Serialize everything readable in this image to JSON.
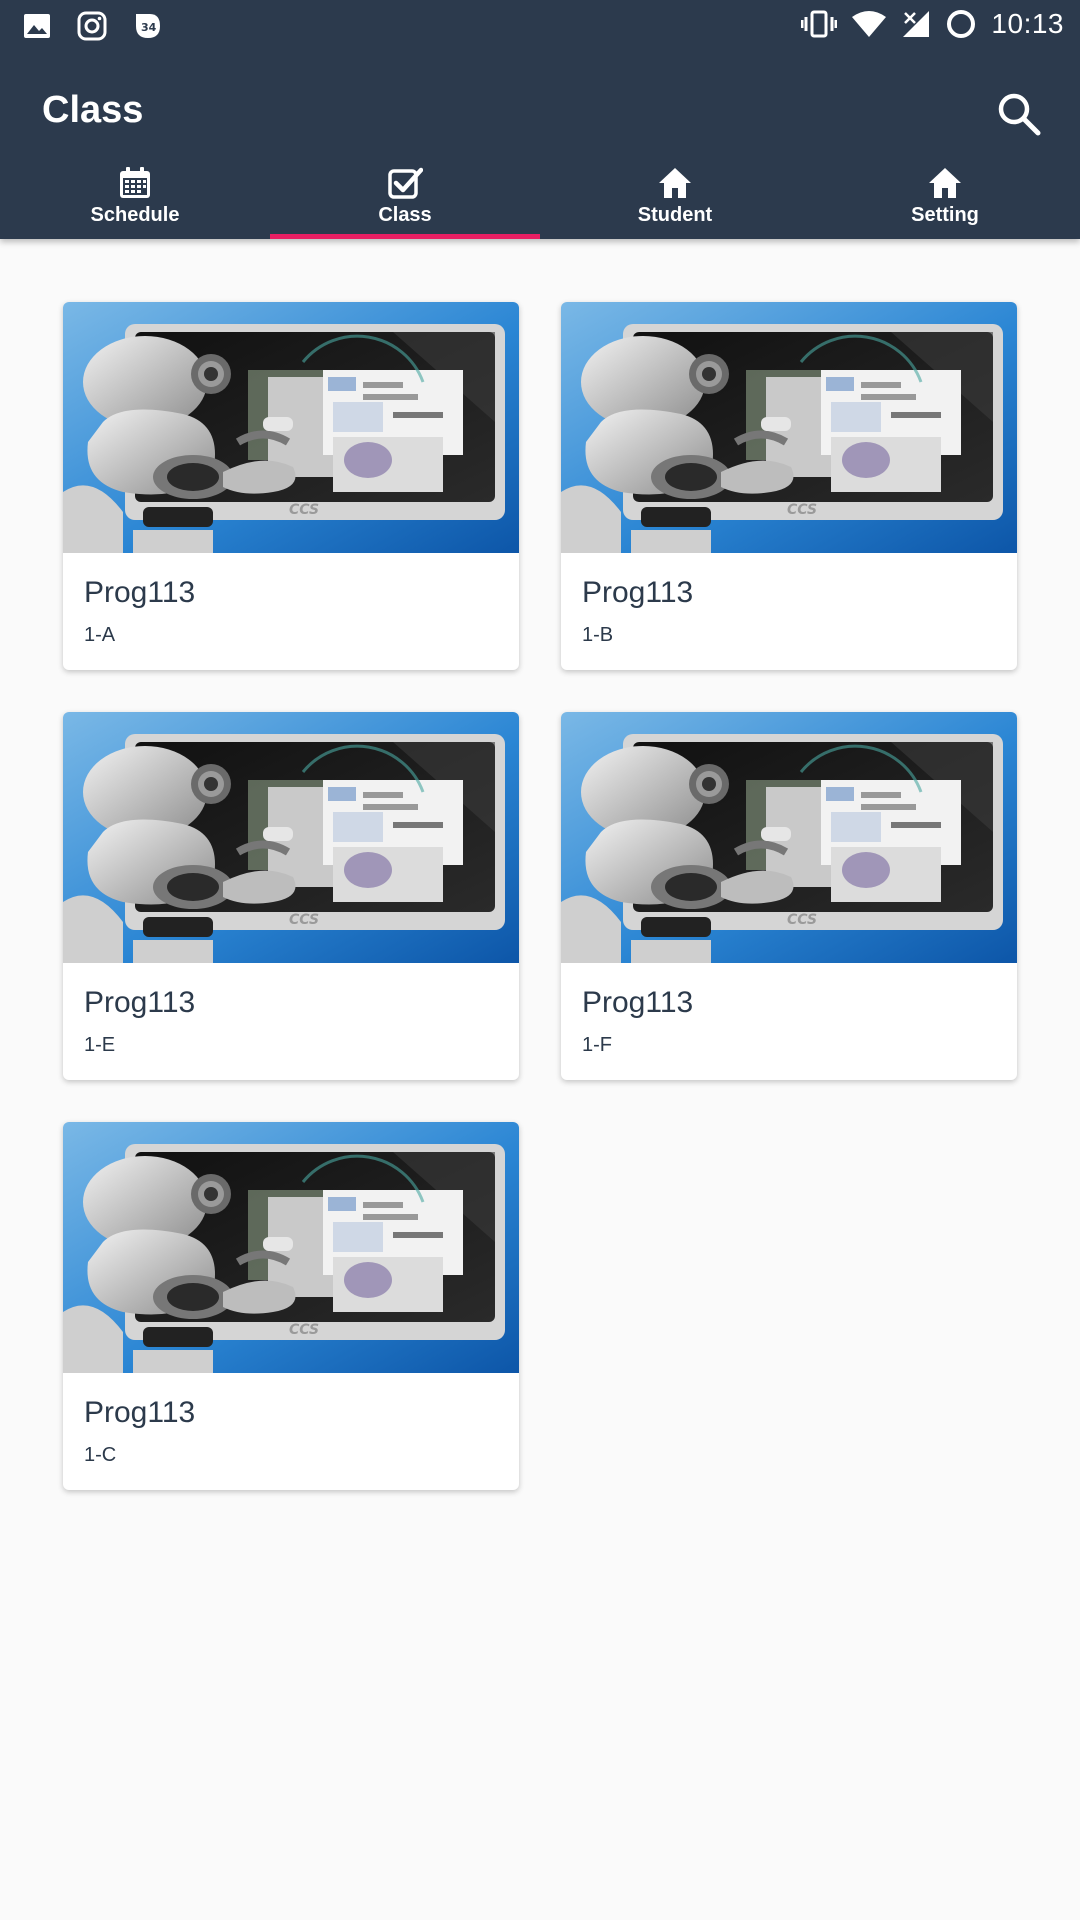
{
  "status_bar": {
    "time": "10:13",
    "notification_badge": "34",
    "icons": [
      "image-icon",
      "instagram-icon",
      "notification-count-icon",
      "vibrate-icon",
      "wifi-icon",
      "signal-icon",
      "sync-icon"
    ]
  },
  "app_bar": {
    "title": "Class",
    "search_icon": "search-icon"
  },
  "tabs": [
    {
      "label": "Schedule",
      "icon": "calendar-icon",
      "active": false
    },
    {
      "label": "Class",
      "icon": "checkbox-icon",
      "active": true
    },
    {
      "label": "Student",
      "icon": "home-icon",
      "active": false
    },
    {
      "label": "Setting",
      "icon": "home-icon",
      "active": false
    }
  ],
  "colors": {
    "app_bar": "#2c3a4d",
    "tab_indicator": "#e91e63",
    "background": "#fafafa"
  },
  "classes": [
    {
      "title": "Prog113",
      "section": "1-A"
    },
    {
      "title": "Prog113",
      "section": "1-B"
    },
    {
      "title": "Prog113",
      "section": "1-E"
    },
    {
      "title": "Prog113",
      "section": "1-F"
    },
    {
      "title": "Prog113",
      "section": "1-C"
    }
  ],
  "card_image": {
    "icon": "robot-computer-illustration",
    "caption": "CCS"
  }
}
